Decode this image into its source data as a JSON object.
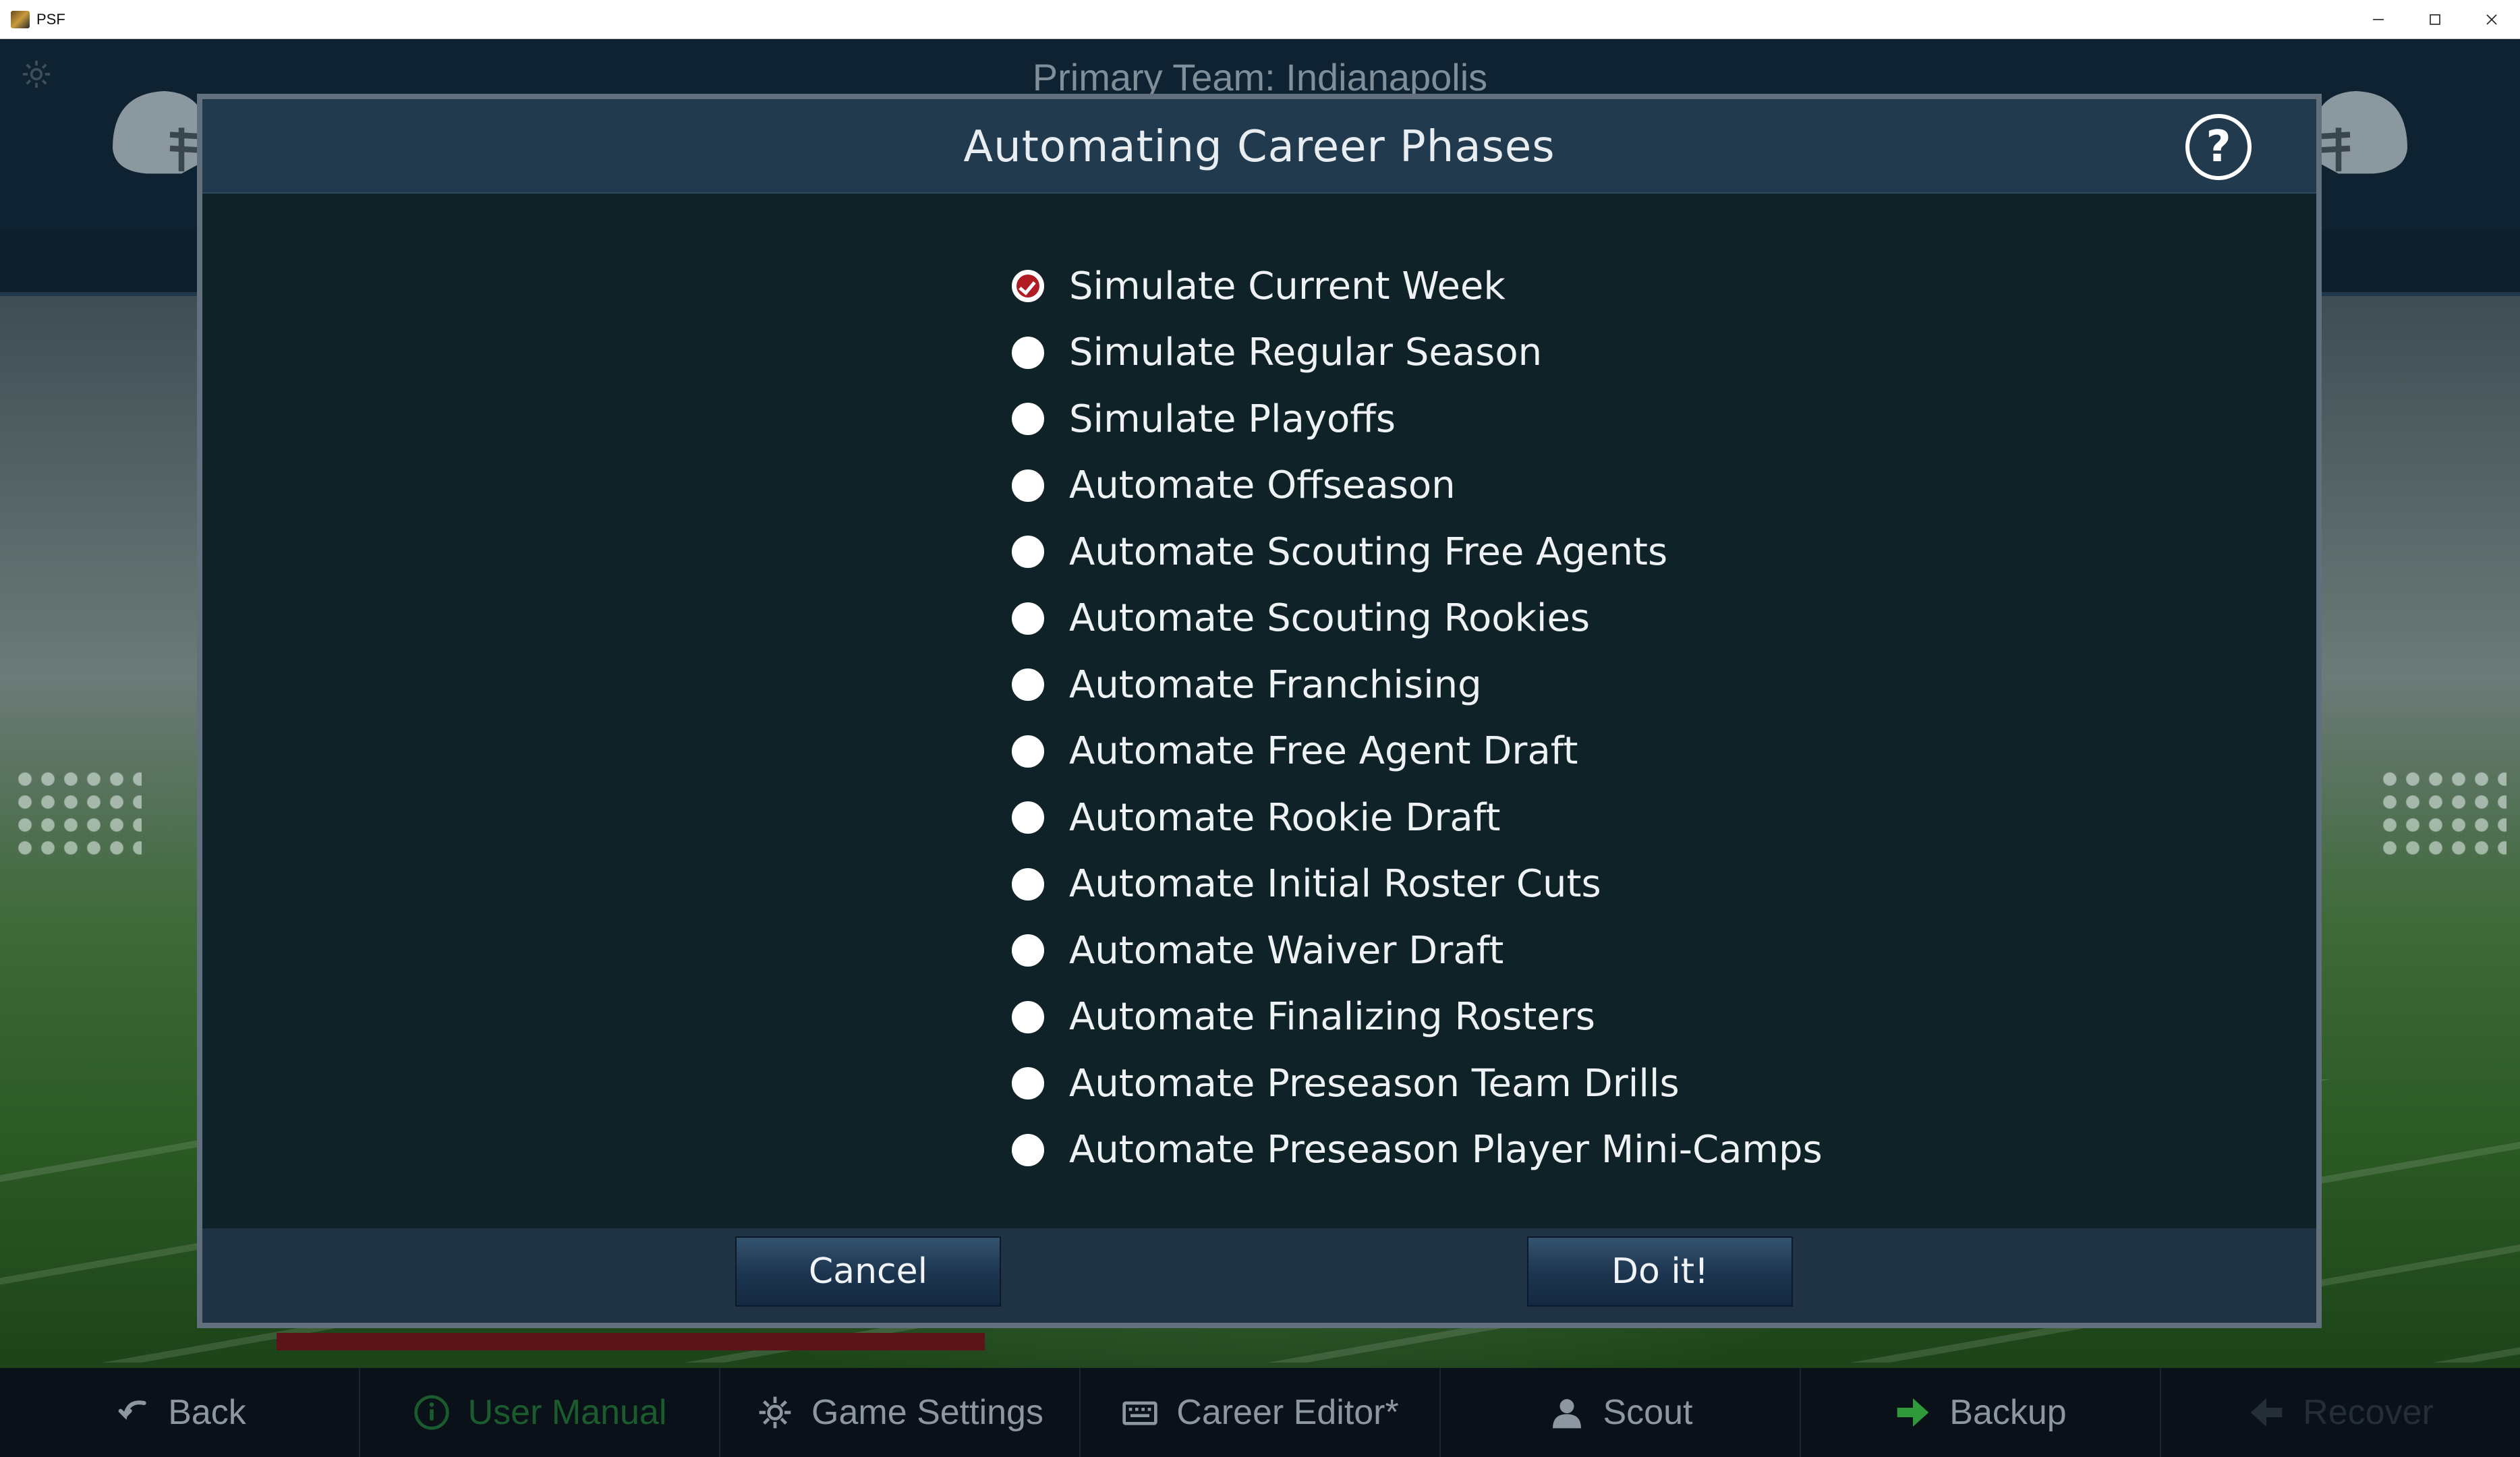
{
  "window": {
    "title": "PSF",
    "controls": [
      "minimize-icon",
      "maximize-icon",
      "close-icon"
    ]
  },
  "background": {
    "primary_team": "Primary Team: Indianapolis"
  },
  "modal": {
    "title": "Automating Career Phases",
    "help_label": "?",
    "options": [
      {
        "label": "Simulate Current Week",
        "selected": true
      },
      {
        "label": "Simulate Regular Season",
        "selected": false
      },
      {
        "label": "Simulate Playoffs",
        "selected": false
      },
      {
        "label": "Automate Offseason",
        "selected": false
      },
      {
        "label": "Automate Scouting Free Agents",
        "selected": false
      },
      {
        "label": "Automate Scouting Rookies",
        "selected": false
      },
      {
        "label": "Automate Franchising",
        "selected": false
      },
      {
        "label": "Automate Free Agent Draft",
        "selected": false
      },
      {
        "label": "Automate Rookie Draft",
        "selected": false
      },
      {
        "label": "Automate Initial Roster Cuts",
        "selected": false
      },
      {
        "label": "Automate Waiver Draft",
        "selected": false
      },
      {
        "label": "Automate Finalizing Rosters",
        "selected": false
      },
      {
        "label": "Automate Preseason Team Drills",
        "selected": false
      },
      {
        "label": "Automate Preseason Player Mini-Camps",
        "selected": false
      }
    ],
    "cancel_label": "Cancel",
    "confirm_label": "Do it!",
    "accent_color": "#b01c22"
  },
  "bottom_nav": {
    "items": [
      {
        "label": "Back",
        "icon": "back-arrow-icon"
      },
      {
        "label": "User Manual",
        "icon": "info-icon"
      },
      {
        "label": "Game Settings",
        "icon": "gear-icon"
      },
      {
        "label": "Career Editor*",
        "icon": "keyboard-icon"
      },
      {
        "label": "Scout",
        "icon": "person-icon"
      },
      {
        "label": "Backup",
        "icon": "forward-arrow-icon"
      },
      {
        "label": "Recover",
        "icon": "recover-icon"
      }
    ]
  }
}
